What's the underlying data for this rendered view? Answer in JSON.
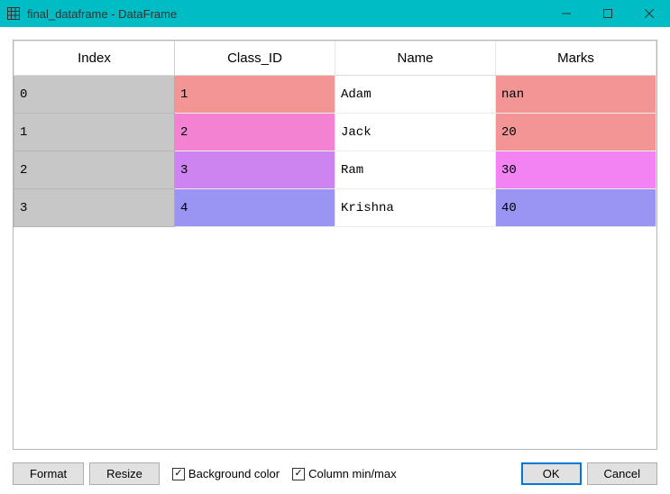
{
  "window": {
    "title": "final_dataframe - DataFrame"
  },
  "table": {
    "columns": [
      "Index",
      "Class_ID",
      "Name",
      "Marks"
    ],
    "rows": [
      {
        "index": "0",
        "class_id": "1",
        "name": "Adam",
        "marks": "nan",
        "class_color": "#f39594",
        "marks_color": "#f39594"
      },
      {
        "index": "1",
        "class_id": "2",
        "name": "Jack",
        "marks": "20",
        "class_color": "#f383d2",
        "marks_color": "#f39594"
      },
      {
        "index": "2",
        "class_id": "3",
        "name": "Ram",
        "marks": "30",
        "class_color": "#cd84f1",
        "marks_color": "#f383f3"
      },
      {
        "index": "3",
        "class_id": "4",
        "name": "Krishna",
        "marks": "40",
        "class_color": "#9a94f3",
        "marks_color": "#9a94f3"
      }
    ]
  },
  "footer": {
    "format": "Format",
    "resize": "Resize",
    "bg_color": "Background color",
    "minmax": "Column min/max",
    "ok": "OK",
    "cancel": "Cancel"
  }
}
